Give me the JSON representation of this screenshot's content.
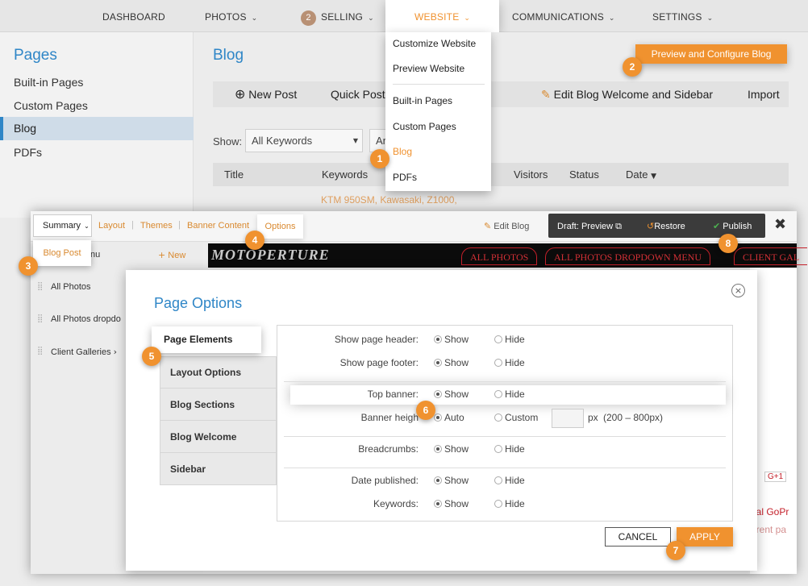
{
  "nav": {
    "dashboard": "DASHBOARD",
    "photos": "PHOTOS",
    "selling_badge": "2",
    "selling": "SELLING",
    "website": "WEBSITE",
    "communications": "COMMUNICATIONS",
    "settings": "SETTINGS"
  },
  "left_panel": {
    "title": "Pages",
    "items": [
      "Built-in Pages",
      "Custom Pages",
      "Blog",
      "PDFs"
    ]
  },
  "blog": {
    "title": "Blog",
    "preview_button": "Preview and Configure Blog",
    "toolbar": {
      "new_post": "New Post",
      "quick_post": "Quick Post",
      "edit_welcome": "Edit Blog Welcome and Sidebar",
      "import": "Import"
    },
    "show_label": "Show:",
    "keywords_select": "All Keywords",
    "second_select": "An",
    "columns": [
      "Title",
      "Keywords",
      "Visitors",
      "Status",
      "Date"
    ],
    "row_keywords": "KTM 950SM, Kawasaki, Z1000,"
  },
  "website_menu": {
    "items": [
      "Customize Website",
      "Preview Website",
      "Built-in Pages",
      "Custom Pages",
      "Blog",
      "PDFs"
    ],
    "active": "Blog"
  },
  "markers": [
    "1",
    "2",
    "3",
    "4",
    "5",
    "6",
    "7",
    "8"
  ],
  "editor": {
    "summary": "Summary",
    "tabs": [
      "Layout",
      "Themes",
      "Banner Content",
      "Options"
    ],
    "edit_blog": "Edit Blog",
    "draft_preview": "Draft: Preview",
    "restore": "Restore",
    "publish": "Publish",
    "blog_post_popup": "Blog Post",
    "menu_header": "nu",
    "new": "New",
    "menu_items": [
      "All Photos",
      "All Photos dropdo",
      "Client Galleries"
    ],
    "site_logo": "MOTOPERTURE",
    "site_tabs": [
      "ALL PHOTOS",
      "ALL PHOTOS DROPDOWN MENU",
      "CLIENT GAL"
    ],
    "site_text_1": "ual GoPr",
    "site_text_2": "erent pa",
    "social": "G+1"
  },
  "modal": {
    "title": "Page Options",
    "tabs": [
      "Page Elements",
      "Layout Options",
      "Blog Sections",
      "Blog Welcome",
      "Sidebar"
    ],
    "rows": {
      "header": {
        "label": "Show page header:",
        "a": "Show",
        "b": "Hide"
      },
      "footer": {
        "label": "Show page footer:",
        "a": "Show",
        "b": "Hide"
      },
      "top_banner": {
        "label": "Top banner:",
        "a": "Show",
        "b": "Hide"
      },
      "banner_height": {
        "label": "Banner heigh",
        "a": "Auto",
        "b": "Custom",
        "unit": "px",
        "range": "(200 – 800px)"
      },
      "breadcrumbs": {
        "label": "Breadcrumbs:",
        "a": "Show",
        "b": "Hide"
      },
      "date_published": {
        "label": "Date published:",
        "a": "Show",
        "b": "Hide"
      },
      "keywords": {
        "label": "Keywords:",
        "a": "Show",
        "b": "Hide"
      }
    },
    "cancel": "CANCEL",
    "apply": "APPLY"
  },
  "colors": {
    "accent": "#f0922f",
    "link_blue": "#2f86c7",
    "brand_red": "#c4202a"
  }
}
